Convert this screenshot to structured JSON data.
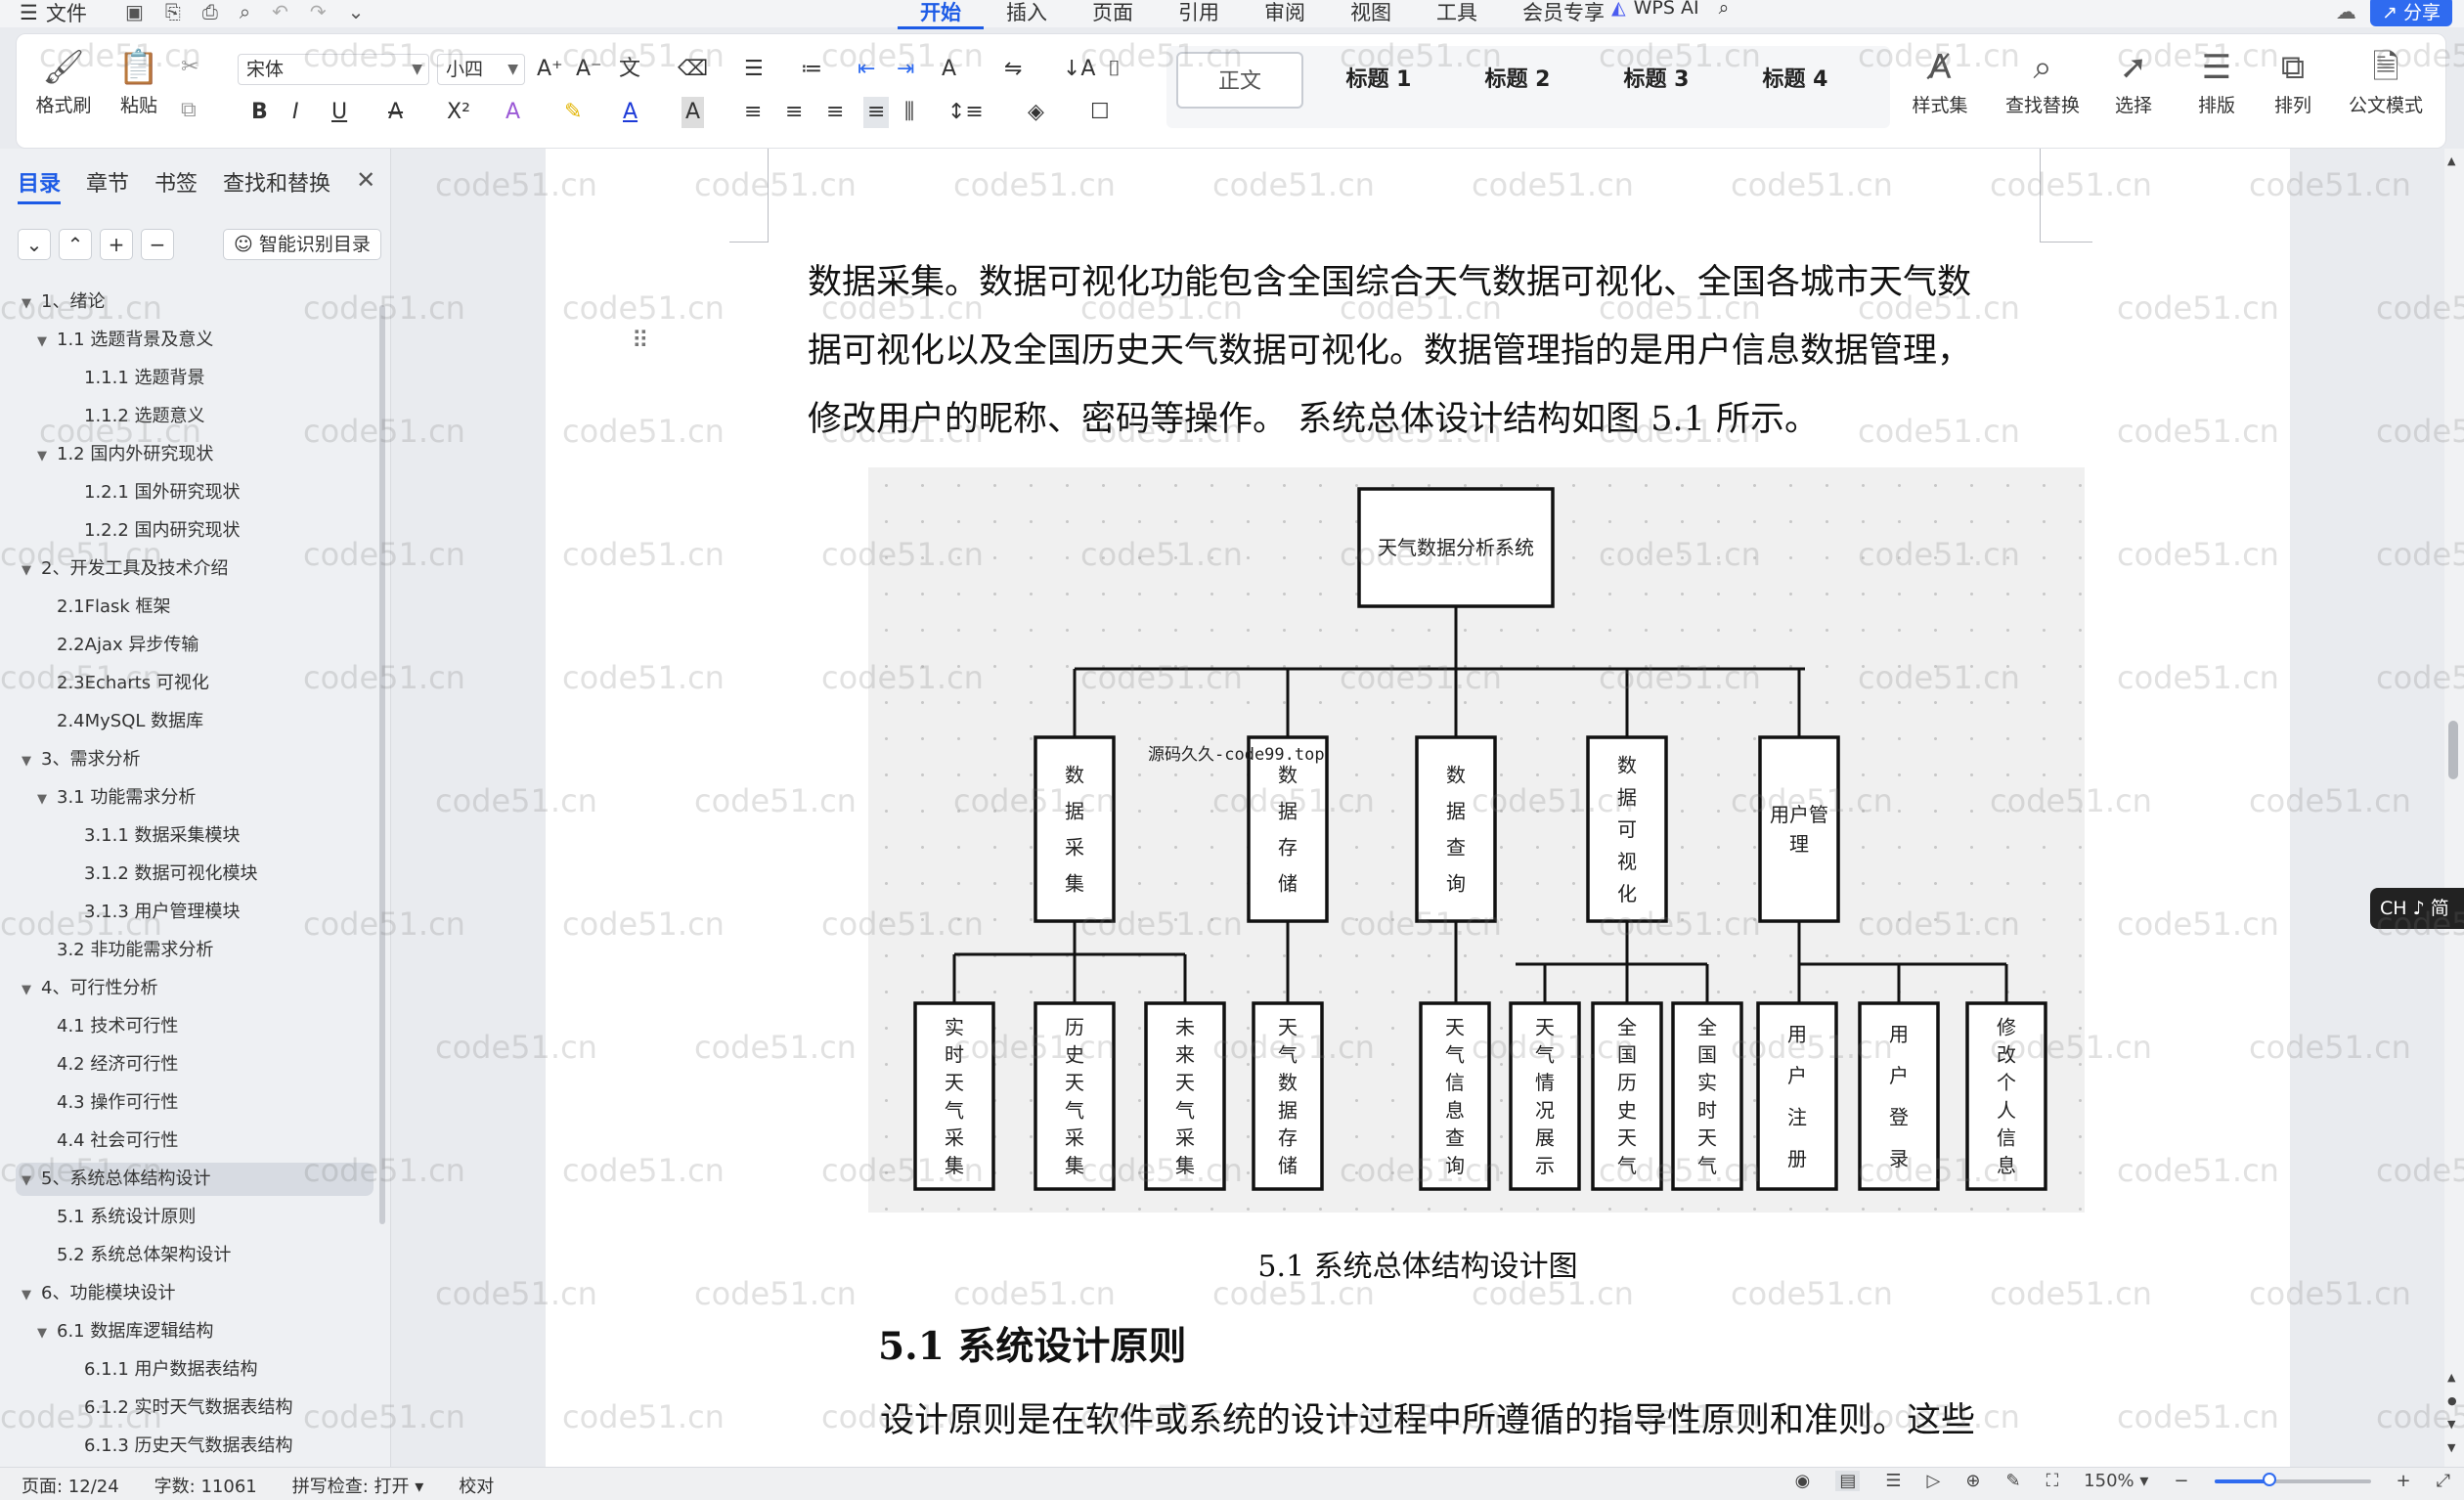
{
  "menubar": {
    "file": "文件",
    "tabs": [
      "开始",
      "插入",
      "页面",
      "引用",
      "审阅",
      "视图",
      "工具",
      "会员专享"
    ],
    "active_tab": "开始",
    "wps_ai": "WPS AI",
    "share": "分享"
  },
  "ribbon": {
    "format_painter": "格式刷",
    "paste": "粘贴",
    "font_name": "宋体",
    "font_size": "小四",
    "styles": [
      "正文",
      "标题 1",
      "标题 2",
      "标题 3",
      "标题 4"
    ],
    "style_set": "样式集",
    "find_replace": "查找替换",
    "select": "选择",
    "layout": "排版",
    "arrange": "排列",
    "official": "公文模式"
  },
  "nav": {
    "tabs": [
      "目录",
      "章节",
      "书签",
      "查找和替换"
    ],
    "smart_toc": "智能识别目录",
    "items": [
      {
        "level": 0,
        "text": "1、绪论",
        "toggle": "▼"
      },
      {
        "level": 1,
        "text": "1.1 选题背景及意义",
        "toggle": "▼"
      },
      {
        "level": 2,
        "text": "1.1.1 选题背景",
        "toggle": ""
      },
      {
        "level": 2,
        "text": "1.1.2 选题意义",
        "toggle": ""
      },
      {
        "level": 1,
        "text": "1.2 国内外研究现状",
        "toggle": "▼"
      },
      {
        "level": 2,
        "text": "1.2.1 国外研究现状",
        "toggle": ""
      },
      {
        "level": 2,
        "text": "1.2.2 国内研究现状",
        "toggle": ""
      },
      {
        "level": 0,
        "text": "2、开发工具及技术介绍",
        "toggle": "▼"
      },
      {
        "level": 1,
        "text": "2.1Flask 框架",
        "toggle": ""
      },
      {
        "level": 1,
        "text": "2.2Ajax 异步传输",
        "toggle": ""
      },
      {
        "level": 1,
        "text": "2.3Echarts 可视化",
        "toggle": ""
      },
      {
        "level": 1,
        "text": "2.4MySQL 数据库",
        "toggle": ""
      },
      {
        "level": 0,
        "text": "3、需求分析",
        "toggle": "▼"
      },
      {
        "level": 1,
        "text": "3.1 功能需求分析",
        "toggle": "▼"
      },
      {
        "level": 2,
        "text": "3.1.1 数据采集模块",
        "toggle": ""
      },
      {
        "level": 2,
        "text": "3.1.2 数据可视化模块",
        "toggle": ""
      },
      {
        "level": 2,
        "text": "3.1.3 用户管理模块",
        "toggle": ""
      },
      {
        "level": 1,
        "text": "3.2 非功能需求分析",
        "toggle": ""
      },
      {
        "level": 0,
        "text": "4、可行性分析",
        "toggle": "▼"
      },
      {
        "level": 1,
        "text": "4.1 技术可行性",
        "toggle": ""
      },
      {
        "level": 1,
        "text": "4.2 经济可行性",
        "toggle": ""
      },
      {
        "level": 1,
        "text": "4.3 操作可行性",
        "toggle": ""
      },
      {
        "level": 1,
        "text": "4.4 社会可行性",
        "toggle": ""
      },
      {
        "level": 0,
        "text": "5、系统总体结构设计",
        "toggle": "▼",
        "active": true
      },
      {
        "level": 1,
        "text": "5.1 系统设计原则",
        "toggle": ""
      },
      {
        "level": 1,
        "text": "5.2 系统总体架构设计",
        "toggle": ""
      },
      {
        "level": 0,
        "text": "6、功能模块设计",
        "toggle": "▼"
      },
      {
        "level": 1,
        "text": "6.1 数据库逻辑结构",
        "toggle": "▼"
      },
      {
        "level": 2,
        "text": "6.1.1 用户数据表结构",
        "toggle": ""
      },
      {
        "level": 2,
        "text": "6.1.2 实时天气数据表结构",
        "toggle": ""
      },
      {
        "level": 2,
        "text": "6.1.3 历史天气数据表结构",
        "toggle": ""
      }
    ]
  },
  "doc": {
    "lines": [
      "数据采集。数据可视化功能包含全国综合天气数据可视化、全国各城市天气数",
      "据可视化以及全国历史天气数据可视化。数据管理指的是用户信息数据管理，",
      "修改用户的昵称、密码等操作。 系统总体设计结构如图 5.1 所示。"
    ],
    "figure": {
      "root": "天气数据分析系统",
      "modules": [
        "数据采集",
        "数据存储",
        "数据查询",
        "数据可视化",
        "用户管理"
      ],
      "leaves": [
        "实时天气采集",
        "历史天气采集",
        "未来天气采集",
        "天气数据存储",
        "天气信息查询",
        "天气情况展示",
        "全国历史天气",
        "全国实时天气",
        "用户注册",
        "用户登录",
        "修改个人信息"
      ],
      "stamp": "源码久久-code99.top"
    },
    "caption": "5.1 系统总体结构设计图",
    "heading": "5.1 系统设计原则",
    "para2": "设计原则是在软件或系统的设计过程中所遵循的指导性原则和准则。这些"
  },
  "ime": "CH ♪ 简",
  "watermark": "code51.cn",
  "status": {
    "page": "页面: 12/24",
    "words": "字数: 11061",
    "spell": "拼写检查: 打开",
    "proof": "校对",
    "zoom": "150%",
    "zoom_fraction": 0.35
  }
}
